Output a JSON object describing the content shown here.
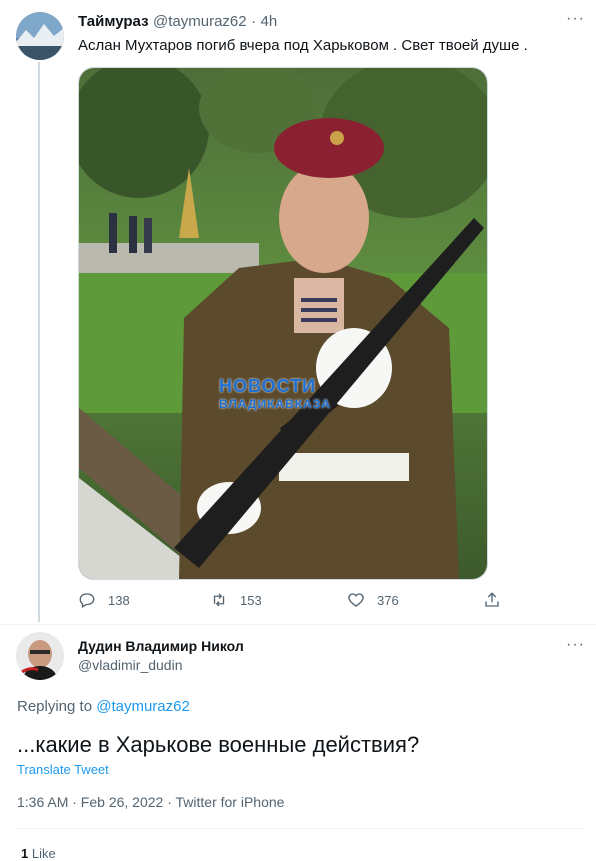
{
  "tweet": {
    "display_name": "Таймураз",
    "handle": "@taymuraz62",
    "separator": "·",
    "time": "4h",
    "text": "Аслан Мухтаров погиб вчера под  Харьковом . Свет твоей душе .",
    "watermark_line1": "НОВОСТИ",
    "watermark_line2": "ВЛАДИКАВКАЗА",
    "replies": "138",
    "retweets": "153",
    "likes": "376"
  },
  "reply": {
    "display_name": "Дудин Владимир Никол",
    "handle": "@vladimir_dudin",
    "replying_prefix": "Replying to",
    "replying_handle": "@taymuraz62",
    "text": "...какие в Харькове военные действия?",
    "translate": "Translate Tweet",
    "timestamp": "1:36 AM · Feb 26, 2022 · Twitter for iPhone",
    "likes_count": "1",
    "likes_label": "Like"
  },
  "colors": {
    "accent": "#1d9bf0",
    "muted": "#536471",
    "border": "#cfd9de"
  },
  "icons": [
    "reply-icon",
    "retweet-icon",
    "like-icon",
    "share-icon",
    "more-icon"
  ]
}
